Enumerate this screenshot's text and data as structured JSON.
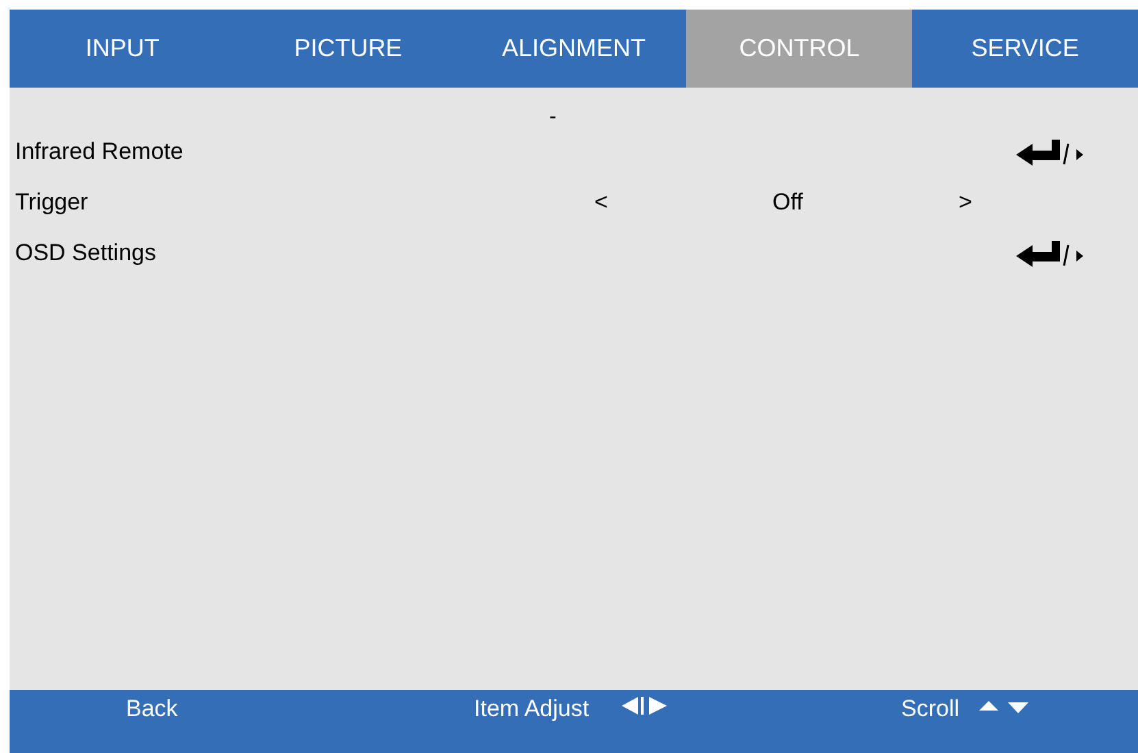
{
  "tabs": [
    {
      "label": "INPUT",
      "selected": false
    },
    {
      "label": "PICTURE",
      "selected": false
    },
    {
      "label": "ALIGNMENT",
      "selected": false
    },
    {
      "label": "CONTROL",
      "selected": true
    },
    {
      "label": "SERVICE",
      "selected": false
    }
  ],
  "scroll_mark": "-",
  "items": [
    {
      "kind": "submenu",
      "label": "Infrared Remote"
    },
    {
      "kind": "option",
      "label": "Trigger",
      "left": "<",
      "value": "Off",
      "right": ">"
    },
    {
      "kind": "submenu",
      "label": "OSD Settings"
    }
  ],
  "footer": {
    "back": "Back",
    "adjust": "Item Adjust",
    "scroll": "Scroll"
  }
}
